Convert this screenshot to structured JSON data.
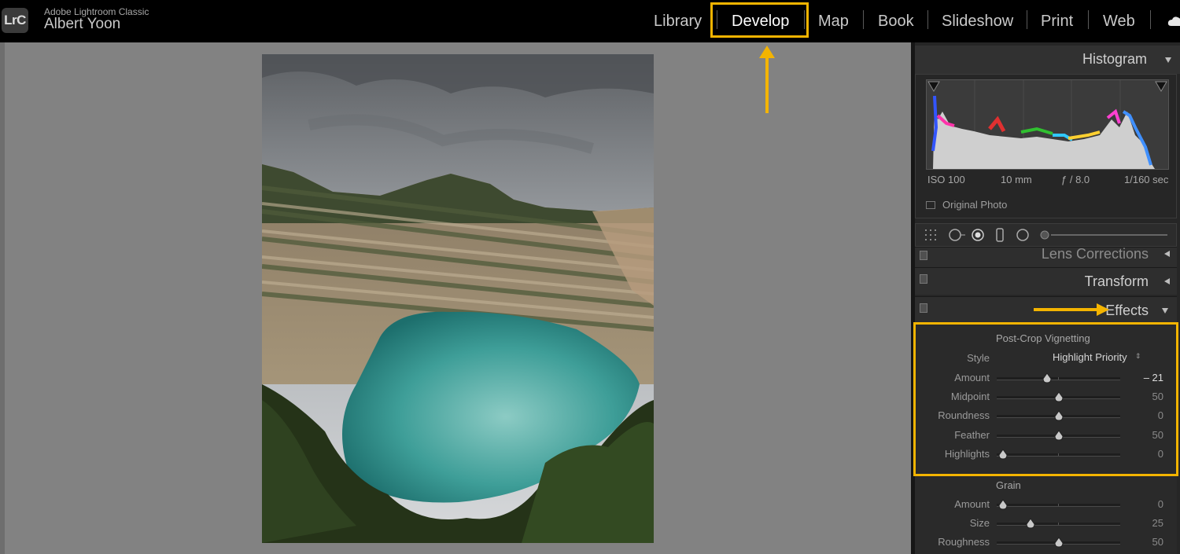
{
  "app": {
    "name": "Adobe Lightroom Classic",
    "logo_text": "LrC",
    "user": "Albert Yoon"
  },
  "modules": [
    "Library",
    "Develop",
    "Map",
    "Book",
    "Slideshow",
    "Print",
    "Web"
  ],
  "active_module": "Develop",
  "histogram": {
    "title": "Histogram",
    "iso": "ISO 100",
    "focal": "10 mm",
    "aperture": "ƒ / 8.0",
    "shutter": "1/160 sec",
    "original_photo_label": "Original Photo"
  },
  "panels": {
    "lens_corrections": "Lens Corrections",
    "transform": "Transform",
    "effects": "Effects"
  },
  "vignetting": {
    "title": "Post-Crop Vignetting",
    "style_label": "Style",
    "style_value": "Highlight Priority",
    "sliders": [
      {
        "label": "Amount",
        "value": "– 21",
        "level": -21,
        "min": -100,
        "max": 100
      },
      {
        "label": "Midpoint",
        "value": "50",
        "level": 50,
        "min": 0,
        "max": 100
      },
      {
        "label": "Roundness",
        "value": "0",
        "level": 0,
        "min": -100,
        "max": 100
      },
      {
        "label": "Feather",
        "value": "50",
        "level": 50,
        "min": 0,
        "max": 100
      },
      {
        "label": "Highlights",
        "value": "0",
        "level": 0,
        "min": 0,
        "max": 100
      }
    ]
  },
  "grain": {
    "title": "Grain",
    "sliders": [
      {
        "label": "Amount",
        "value": "0",
        "level": 0,
        "min": 0,
        "max": 100
      },
      {
        "label": "Size",
        "value": "25",
        "level": 25,
        "min": 0,
        "max": 100
      },
      {
        "label": "Roughness",
        "value": "50",
        "level": 50,
        "min": 0,
        "max": 100
      }
    ]
  },
  "colors": {
    "highlight": "#f4b400",
    "canvas_bg": "#828282",
    "panel_bg": "#262626"
  },
  "icons": [
    "cloud-icon",
    "grid-icon",
    "crop-icon",
    "spot-removal-icon",
    "red-eye-icon",
    "masking-icon",
    "exposure-slider-icon"
  ]
}
